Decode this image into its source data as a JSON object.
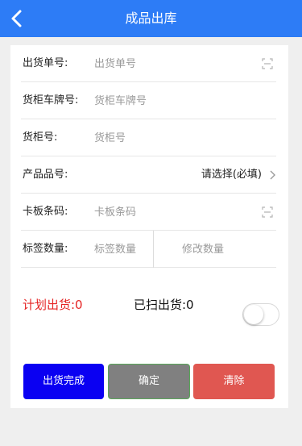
{
  "header": {
    "title": "成品出库",
    "back_icon": "chevron-left-icon"
  },
  "form": {
    "shipment_no": {
      "label": "出货单号:",
      "placeholder": "出货单号",
      "value": ""
    },
    "plate_no": {
      "label": "货柜车牌号:",
      "placeholder": "货柜车牌号",
      "value": ""
    },
    "container_no": {
      "label": "货柜号:",
      "placeholder": "货柜号",
      "value": ""
    },
    "product_no": {
      "label": "产品品号:",
      "value": "请选择(必填)"
    },
    "pallet_code": {
      "label": "卡板条码:",
      "placeholder": "卡板条码",
      "value": ""
    },
    "label_qty": {
      "label": "标签数量:",
      "placeholder": "标签数量",
      "modify_placeholder": "修改数量",
      "value": ""
    }
  },
  "stats": {
    "planned": "计划出货:0",
    "scanned": "已扫出货:0",
    "planned_color": "#e52424"
  },
  "toggle": {
    "on": false
  },
  "buttons": {
    "finish": "出货完成",
    "confirm": "确定",
    "clear": "清除",
    "finish_color": "#0a00f2",
    "confirm_color": "#808080",
    "clear_color": "#e05751"
  },
  "colors": {
    "header": "#2d7cf6"
  }
}
